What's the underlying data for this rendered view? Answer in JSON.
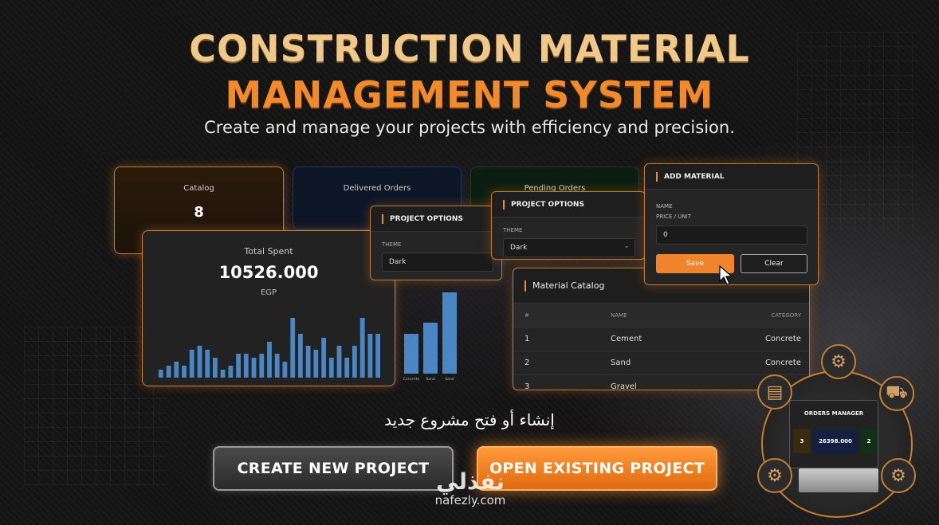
{
  "hero": {
    "title_line1": "CONSTRUCTION MATERIAL",
    "title_line2": "MANAGEMENT SYSTEM",
    "subtitle": "Create and manage your projects with efficiency and precision."
  },
  "stats": {
    "catalog_label": "Catalog",
    "catalog_value": "8",
    "delivered_label": "Delivered Orders",
    "pending_label": "Pending Orders",
    "total_spent_label": "Total Spent",
    "total_spent_value": "10526.000",
    "currency": "EGP"
  },
  "mini_bar_labels": [
    "Concrete",
    "Sand",
    "Sand"
  ],
  "project_options_1": {
    "title": "PROJECT OPTIONS",
    "theme_label": "THEME",
    "theme_value": "Dark"
  },
  "project_options_2": {
    "title": "PROJECT OPTIONS",
    "theme_label": "THEME",
    "theme_value": "Dark"
  },
  "add_material": {
    "title": "ADD MATERIAL",
    "name_label": "NAME",
    "price_label": "PRICE / UNIT",
    "price_value": "0",
    "save_label": "Save",
    "clear_label": "Clear"
  },
  "material_catalog": {
    "title": "Material Catalog",
    "columns": [
      "#",
      "NAME",
      "CATEGORY"
    ],
    "rows": [
      {
        "n": "1",
        "name": "Cement",
        "category": "Concrete"
      },
      {
        "n": "2",
        "name": "Sand",
        "category": "Concrete"
      },
      {
        "n": "3",
        "name": "Gravel",
        "category": ""
      }
    ]
  },
  "arabic_caption": "إنشاء أو فتح مشروع جديد",
  "buttons": {
    "create": "CREATE NEW PROJECT",
    "open": "OPEN EXISTING PROJECT"
  },
  "orders_manager": {
    "title": "ORDERS MANAGER",
    "v1": "3",
    "v2": "26398.000",
    "v3": "2"
  },
  "watermark": {
    "arabic": "نفذلي",
    "url": "nafezly.com"
  },
  "colors": {
    "accent": "#f0842a",
    "gold": "#f0c98a",
    "bar": "#4a86c4"
  },
  "chart_data": {
    "type": "bar",
    "title": "Total Spent",
    "values": [
      2,
      3,
      4,
      3,
      7,
      8,
      7,
      5,
      2,
      3,
      6,
      6,
      5,
      6,
      9,
      6,
      4,
      15,
      11,
      8,
      7,
      10,
      5,
      8,
      5,
      8,
      15,
      11,
      11
    ],
    "ylim": [
      0,
      16
    ]
  }
}
